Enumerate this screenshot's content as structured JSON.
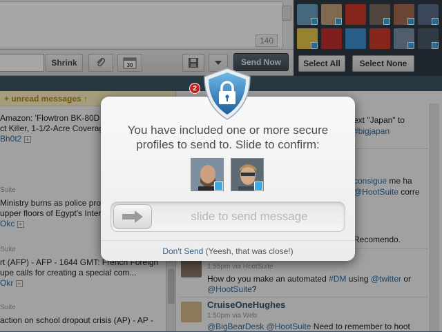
{
  "composer": {
    "char_count": "140",
    "shrink_label": "Shrink",
    "send_now_label": "Send Now",
    "select_all_label": "Select All",
    "select_none_label": "Select None"
  },
  "left_stream": {
    "unread_label": "+ unread messages ↑",
    "posts": [
      {
        "text": "Amazon: 'Flowtron BK-80D 8",
        "text2": "ct Killer, 1-1/2-Acre Coverag",
        "link": "Bh0t2"
      },
      {
        "source": "Suite",
        "text": "Ministry burns as police pro",
        "text2": "upper floors of Egypt's Inter",
        "link": "Okc"
      },
      {
        "source": "Suite",
        "text": "rt (AFP) - AFP - 1644 GMT: French Foreign",
        "text2": "upe calls for creating a special com...",
        "link": "Okr"
      },
      {
        "source": "Suite",
        "text": "action on school dropout crisis (AP) - AP -"
      }
    ]
  },
  "right_stream": {
    "post1_line1": "ext \"Japan\" to",
    "post1_tag": "#bigjapan",
    "post2_link1": "consigue",
    "post2_text1": " me ha",
    "post2_link2": "@HootSuite",
    "post2_text2": " corre",
    "post3_text": "Recomendo.",
    "post4_meta": "1:55pm via HootSuite",
    "post4_text_a": "How do you make an automated ",
    "post4_tag": "#DM",
    "post4_text_b": " using ",
    "post4_mention1": "@twitter",
    "post4_text_c": " or",
    "post4_mention2": "@HootSuite",
    "post4_text_d": "?",
    "post5_user": "CruiseOneHughes",
    "post5_meta": "1:50pm via Web",
    "post5_mention1": "@BigBearDesk",
    "post5_mention2": "@HootSuite",
    "post5_text": " Need to remember to hoot"
  },
  "notification_badge": "2",
  "modal": {
    "title_line1": "You have included one or more secure",
    "title_line2": "profiles to send to. Slide to confirm:",
    "slider_label": "slide to send message",
    "dont_send_label": "Don't Send",
    "footer_note": " (Yeesh, that was close!)"
  },
  "icons": {
    "lock": "lock-shield-icon",
    "arrow": "arrow-right-icon",
    "twitter": "twitter-badge-icon",
    "paperclip": "paperclip-icon",
    "calendar": "calendar-icon",
    "save": "floppy-disk-icon",
    "dropdown": "chevron-down-icon"
  },
  "calendar_day": "30",
  "colors": {
    "accent": "#3d5668",
    "link": "#2c6aa0",
    "twitter": "#39a6e1"
  }
}
